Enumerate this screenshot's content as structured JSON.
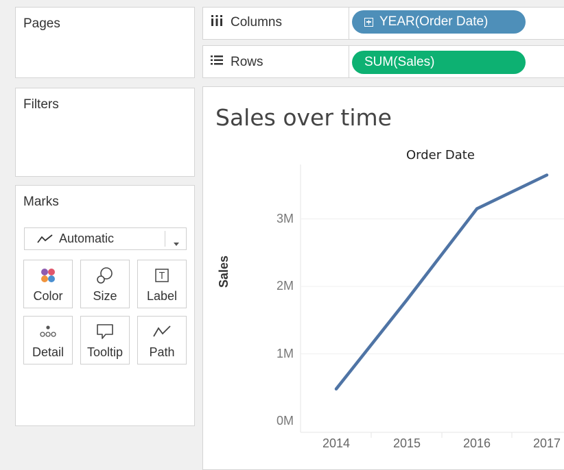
{
  "left_panel": {
    "pages_title": "Pages",
    "filters_title": "Filters",
    "marks_title": "Marks",
    "mark_type": "Automatic",
    "mark_buttons": [
      {
        "label": "Color",
        "icon": "color-dots-icon"
      },
      {
        "label": "Size",
        "icon": "size-icon"
      },
      {
        "label": "Label",
        "icon": "label-icon"
      },
      {
        "label": "Detail",
        "icon": "detail-icon"
      },
      {
        "label": "Tooltip",
        "icon": "tooltip-icon"
      },
      {
        "label": "Path",
        "icon": "path-icon"
      }
    ]
  },
  "shelves": {
    "columns_label": "Columns",
    "columns_pill": "YEAR(Order Date)",
    "rows_label": "Rows",
    "rows_pill": "SUM(Sales)"
  },
  "colors": {
    "columns_pill": "#4e8fb9",
    "rows_pill": "#0db172",
    "line": "#4f74a5"
  },
  "view": {
    "title": "Sales over time"
  },
  "chart_data": {
    "type": "line",
    "x_header": "Order Date",
    "ylabel": "Sales",
    "x": [
      "2014",
      "2015",
      "2016",
      "2017"
    ],
    "series": [
      {
        "values": [
          480000,
          1800000,
          3150000,
          3650000
        ]
      }
    ],
    "y_ticks": [
      "0M",
      "1M",
      "2M",
      "3M"
    ],
    "ylim": [
      0,
      3800000
    ],
    "grid": true
  }
}
